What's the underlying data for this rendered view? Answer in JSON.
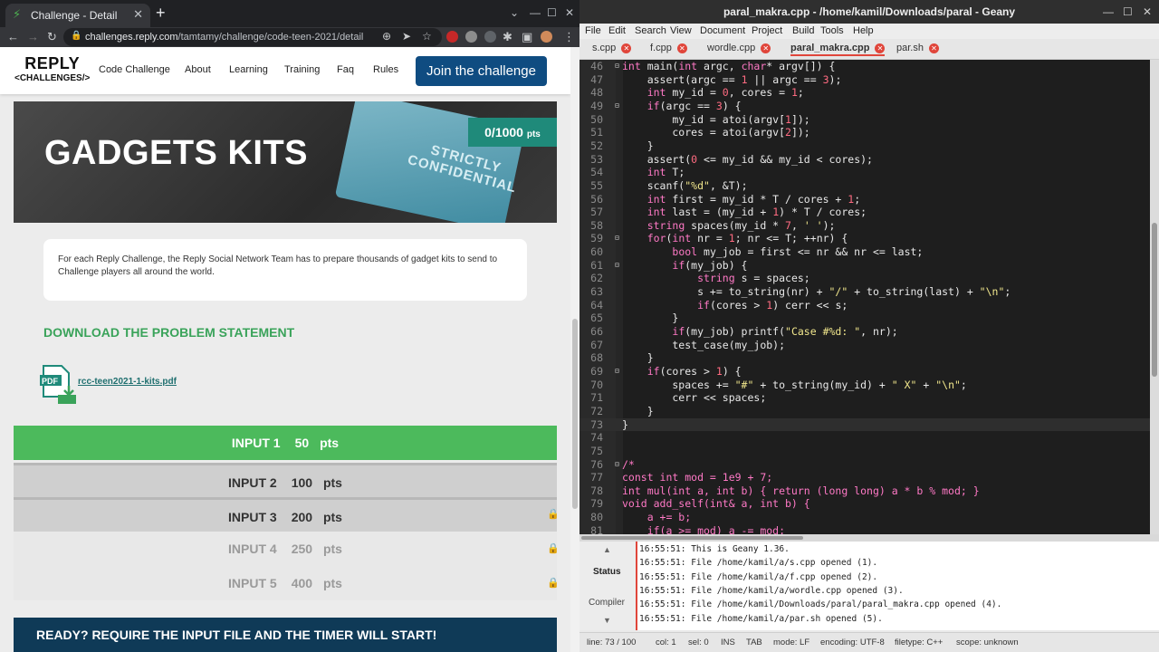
{
  "browser": {
    "tab_title": "Challenge - Detail",
    "url_host": "challenges.reply.com",
    "url_path": "/tamtamy/challenge/code-teen-2021/detail"
  },
  "site": {
    "logo_top": "REPLY",
    "logo_bottom": "<CHALLENGES/>",
    "nav": [
      "Code Challenge",
      "About",
      "Learning",
      "Training",
      "Faq",
      "Rules"
    ],
    "join_label": "Join the challenge",
    "hero_title": "GADGETS KITS",
    "hero_points": "0/1000",
    "hero_points_unit": "pts",
    "hero_card_text": "STRICTLY CONFIDENTIAL",
    "description": "For each Reply Challenge, the Reply Social Network Team has to prepare thousands of gadget kits to send to Challenge players all around the world.",
    "download_heading": "DOWNLOAD THE PROBLEM STATEMENT",
    "pdf_icon_text": "PDF",
    "pdf_name": "rcc-teen2021-1-kits.pdf",
    "inputs": [
      {
        "label": "INPUT 1",
        "points": "50",
        "unit": "pts",
        "state": "active"
      },
      {
        "label": "INPUT 2",
        "points": "100",
        "unit": "pts",
        "state": "available"
      },
      {
        "label": "INPUT 3",
        "points": "200",
        "unit": "pts",
        "state": "available"
      },
      {
        "label": "INPUT 4",
        "points": "250",
        "unit": "pts",
        "state": "locked"
      },
      {
        "label": "INPUT 5",
        "points": "400",
        "unit": "pts",
        "state": "locked"
      }
    ],
    "ready_text": "READY? REQUIRE THE INPUT FILE AND THE TIMER WILL START!"
  },
  "geany": {
    "title": "paral_makra.cpp - /home/kamil/Downloads/paral - Geany",
    "menu": [
      "File",
      "Edit",
      "Search",
      "View",
      "Document",
      "Project",
      "Build",
      "Tools",
      "Help"
    ],
    "tabs": [
      {
        "name": "s.cpp",
        "active": false
      },
      {
        "name": "f.cpp",
        "active": false
      },
      {
        "name": "wordle.cpp",
        "active": false
      },
      {
        "name": "paral_makra.cpp",
        "active": true
      },
      {
        "name": "par.sh",
        "active": false
      }
    ],
    "code_lines": [
      {
        "n": "46",
        "t": "int main(int argc, char* argv[]) {"
      },
      {
        "n": "47",
        "t": "    assert(argc == 1 || argc == 3);"
      },
      {
        "n": "48",
        "t": "    int my_id = 0, cores = 1;"
      },
      {
        "n": "49",
        "t": "    if(argc == 3) {"
      },
      {
        "n": "50",
        "t": "        my_id = atoi(argv[1]);"
      },
      {
        "n": "51",
        "t": "        cores = atoi(argv[2]);"
      },
      {
        "n": "52",
        "t": "    }"
      },
      {
        "n": "53",
        "t": "    assert(0 <= my_id && my_id < cores);"
      },
      {
        "n": "54",
        "t": "    int T;"
      },
      {
        "n": "55",
        "t": "    scanf(\"%d\", &T);"
      },
      {
        "n": "56",
        "t": "    int first = my_id * T / cores + 1;"
      },
      {
        "n": "57",
        "t": "    int last = (my_id + 1) * T / cores;"
      },
      {
        "n": "58",
        "t": "    string spaces(my_id * 7, ' ');"
      },
      {
        "n": "59",
        "t": "    for(int nr = 1; nr <= T; ++nr) {"
      },
      {
        "n": "60",
        "t": "        bool my_job = first <= nr && nr <= last;"
      },
      {
        "n": "61",
        "t": "        if(my_job) {"
      },
      {
        "n": "62",
        "t": "            string s = spaces;"
      },
      {
        "n": "63",
        "t": "            s += to_string(nr) + \"/\" + to_string(last) + \"\\n\";"
      },
      {
        "n": "64",
        "t": "            if(cores > 1) cerr << s;"
      },
      {
        "n": "65",
        "t": "        }"
      },
      {
        "n": "66",
        "t": "        if(my_job) printf(\"Case #%d: \", nr);"
      },
      {
        "n": "67",
        "t": "        test_case(my_job);"
      },
      {
        "n": "68",
        "t": "    }"
      },
      {
        "n": "69",
        "t": "    if(cores > 1) {"
      },
      {
        "n": "70",
        "t": "        spaces += \"#\" + to_string(my_id) + \" X\" + \"\\n\";"
      },
      {
        "n": "71",
        "t": "        cerr << spaces;"
      },
      {
        "n": "72",
        "t": "    }"
      },
      {
        "n": "73",
        "t": "}"
      },
      {
        "n": "74",
        "t": ""
      },
      {
        "n": "75",
        "t": ""
      },
      {
        "n": "76",
        "t": "/*"
      },
      {
        "n": "77",
        "t": "const int mod = 1e9 + 7;"
      },
      {
        "n": "78",
        "t": "int mul(int a, int b) { return (long long) a * b % mod; }"
      },
      {
        "n": "79",
        "t": "void add_self(int& a, int b) {"
      },
      {
        "n": "80",
        "t": "    a += b;"
      },
      {
        "n": "81",
        "t": "    if(a >= mod) a -= mod;"
      }
    ],
    "messages": [
      "16:55:51: This is Geany 1.36.",
      "16:55:51: File /home/kamil/a/s.cpp opened (1).",
      "16:55:51: File /home/kamil/a/f.cpp opened (2).",
      "16:55:51: File /home/kamil/a/wordle.cpp opened (3).",
      "16:55:51: File /home/kamil/Downloads/paral/paral_makra.cpp opened (4).",
      "16:55:51: File /home/kamil/a/par.sh opened (5)."
    ],
    "msg_tabs": {
      "status": "Status",
      "compiler": "Compiler"
    },
    "statusbar": {
      "line": "line: 73 / 100",
      "col": "col: 1",
      "sel": "sel: 0",
      "ins": "INS",
      "tab": "TAB",
      "mode": "mode: LF",
      "encoding": "encoding: UTF-8",
      "filetype": "filetype: C++",
      "scope": "scope: unknown"
    }
  },
  "colors": {
    "input_active": "#4cba5c",
    "input_available": "#cfcfcf",
    "input_locked": "#e8e8e8",
    "accent_green": "#3aa35a",
    "join_blue": "#0f4c81",
    "geany_tab_close": "#e0453a"
  }
}
